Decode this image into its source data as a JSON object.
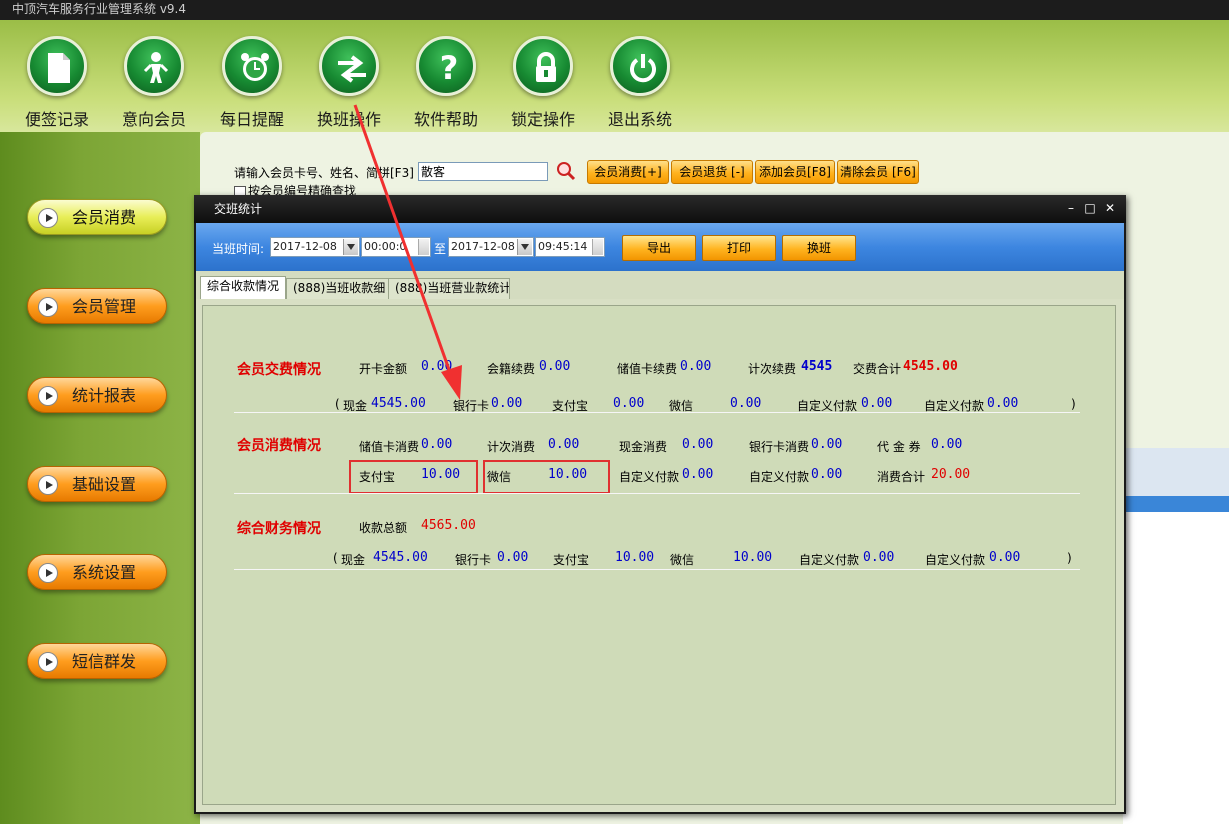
{
  "app": {
    "title": "中顶汽车服务行业管理系统 v9.4"
  },
  "toolbar": [
    {
      "label": "便签记录",
      "icon": "document-icon"
    },
    {
      "label": "意向会员",
      "icon": "person-icon"
    },
    {
      "label": "每日提醒",
      "icon": "alarm-clock-icon"
    },
    {
      "label": "换班操作",
      "icon": "swap-arrows-icon"
    },
    {
      "label": "软件帮助",
      "icon": "question-icon"
    },
    {
      "label": "锁定操作",
      "icon": "lock-icon"
    },
    {
      "label": "退出系统",
      "icon": "power-icon"
    }
  ],
  "sidebar": [
    {
      "label": "会员消费"
    },
    {
      "label": "会员管理"
    },
    {
      "label": "统计报表"
    },
    {
      "label": "基础设置"
    },
    {
      "label": "系统设置"
    },
    {
      "label": "短信群发"
    }
  ],
  "search": {
    "label": "请输入会员卡号、姓名、简拼[F3]",
    "value": "散客",
    "exact_label": "按会员编号精确查找",
    "buttons": [
      "会员消费[+]",
      "会员退货 [-]",
      "添加会员[F8]",
      "清除会员 [F6]"
    ]
  },
  "dialog": {
    "title": "交班统计",
    "controls": {
      "minimize": "–",
      "maximize": "□",
      "close": "✕"
    },
    "shift_time_label": "当班时间:",
    "start_date": "2017-12-08",
    "start_time": "00:00:0",
    "to_label": "至",
    "end_date": "2017-12-08",
    "end_time": "09:45:14",
    "buttons": {
      "export": "导出",
      "print": "打印",
      "shift": "换班"
    },
    "tabs": [
      "综合收款情况",
      "(888)当班收款细",
      "(888)当班营业款统计"
    ],
    "fee_section": {
      "title": "会员交费情况",
      "open_card_label": "开卡金额",
      "open_card_value": "0.00",
      "membership_label": "会籍续费",
      "membership_value": "0.00",
      "stored_label": "储值卡续费",
      "stored_value": "0.00",
      "count_label": "计次续费",
      "count_value": "4545",
      "total_label": "交费合计",
      "total_value": "4545.00",
      "paren_open": "(",
      "paren_close": ")",
      "cash_label": "现金",
      "cash_value": "4545.00",
      "bank_label": "银行卡",
      "bank_value": "0.00",
      "alipay_label": "支付宝",
      "alipay_value": "0.00",
      "wechat_label": "微信",
      "wechat_value": "0.00",
      "custom1_label": "自定义付款",
      "custom1_value": "0.00",
      "custom2_label": "自定义付款",
      "custom2_value": "0.00"
    },
    "consume_section": {
      "title": "会员消费情况",
      "stored_label": "储值卡消费",
      "stored_value": "0.00",
      "count_label": "计次消费",
      "count_value": "0.00",
      "cash_label": "现金消费",
      "cash_value": "0.00",
      "bank_label": "银行卡消费",
      "bank_value": "0.00",
      "voucher_label": "代 金 券",
      "voucher_value": "0.00",
      "alipay_label": "支付宝",
      "alipay_value": "10.00",
      "wechat_label": "微信",
      "wechat_value": "10.00",
      "custom1_label": "自定义付款",
      "custom1_value": "0.00",
      "custom2_label": "自定义付款",
      "custom2_value": "0.00",
      "total_label": "消费合计",
      "total_value": "20.00"
    },
    "finance_section": {
      "title": "综合财务情况",
      "total_label": "收款总额",
      "total_value": "4565.00",
      "paren_open": "(",
      "paren_close": ")",
      "cash_label": "现金",
      "cash_value": "4545.00",
      "bank_label": "银行卡",
      "bank_value": "0.00",
      "alipay_label": "支付宝",
      "alipay_value": "10.00",
      "wechat_label": "微信",
      "wechat_value": "10.00",
      "custom1_label": "自定义付款",
      "custom1_value": "0.00",
      "custom2_label": "自定义付款",
      "custom2_value": "0.00"
    }
  },
  "colors": {
    "highlight": "#e03030",
    "value_blue": "#0000cc",
    "value_red": "#e00000",
    "dialog_bar": "#3d86e0"
  }
}
